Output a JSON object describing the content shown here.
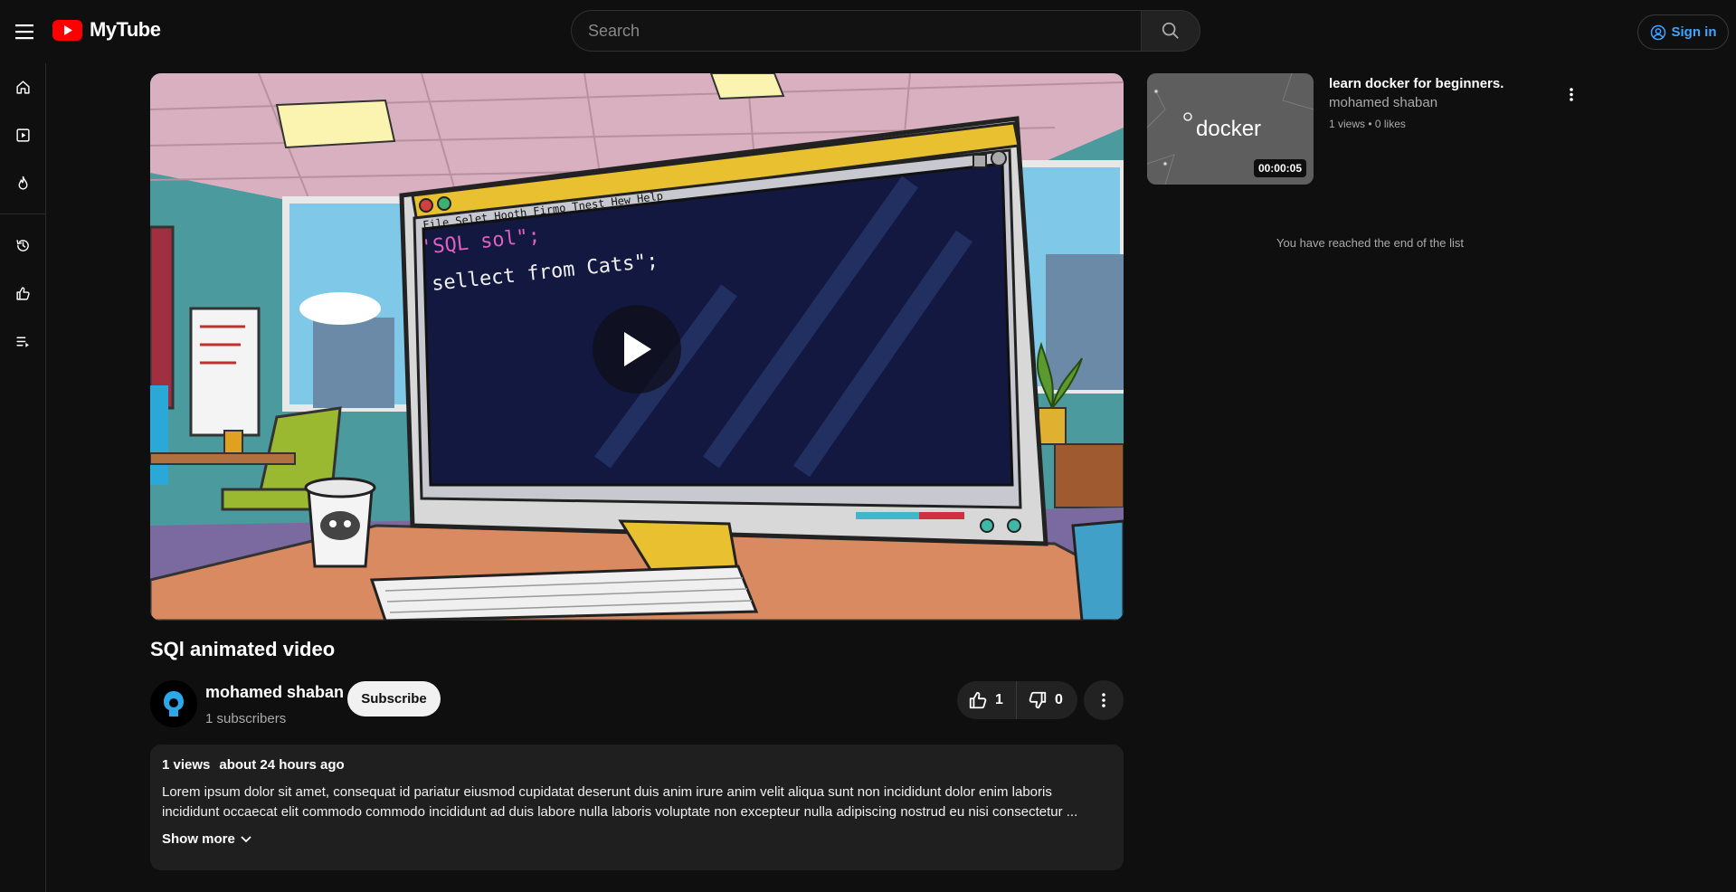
{
  "app": {
    "name": "MyTube"
  },
  "header": {
    "search_placeholder": "Search",
    "signin_label": "Sign in"
  },
  "sidebar": {
    "items": [
      {
        "name": "home-icon"
      },
      {
        "name": "subscriptions-icon"
      },
      {
        "name": "trending-icon"
      },
      {
        "name": "history-icon"
      },
      {
        "name": "liked-icon"
      },
      {
        "name": "playlist-icon"
      }
    ]
  },
  "video": {
    "title": "SQl animated video",
    "channel_name": "mohamed shaban",
    "subscribers": "1 subscribers",
    "subscribe_label": "Subscribe",
    "likes": "1",
    "dislikes": "0",
    "views": "1 views",
    "uploaded": "about 24 hours ago",
    "description": "Lorem ipsum dolor sit amet, consequat id pariatur eiusmod cupidatat deserunt duis anim irure anim velit aliqua sunt non incididunt dolor enim laboris incididunt occaecat elit commodo commodo incididunt ad duis labore nulla laboris voluptate non excepteur nulla adipiscing nostrud eu nisi consectetur ...",
    "show_more_label": "Show more",
    "screen_line1": "'SQL sol\";",
    "screen_line2": "sellect from Cats\";",
    "menu_bar": "File  Selet  Hooth  Firmo  Tnest  Hew  Help"
  },
  "recommendations": [
    {
      "title": "learn docker for beginners.",
      "channel": "mohamed shaban",
      "stats": "1 views • 0 likes",
      "duration": "00:00:05",
      "thumb_text": "docker"
    }
  ],
  "end_of_list": "You have reached the end of the list",
  "colors": {
    "brand_red": "#ff0000",
    "accent_blue": "#3ea6ff",
    "background": "#0f0f0f"
  }
}
